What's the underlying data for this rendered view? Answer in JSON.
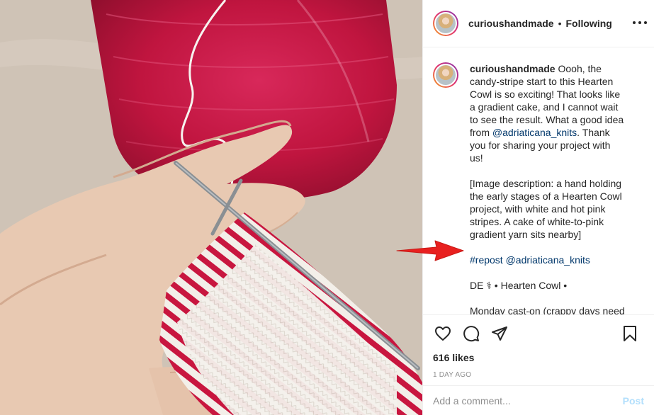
{
  "post": {
    "image_alt": "Hand holding a Hearten Cowl knitting project with white and hot pink stripes, with a cake of white-to-pink gradient yarn nearby",
    "header": {
      "username": "curioushandmade",
      "separator": "•",
      "follow_status": "Following"
    },
    "caption": {
      "username": "curioushandmade",
      "text1": " Oooh, the candy-stripe start to this Hearten Cowl is so exciting! That looks like a gradient cake, and I cannot wait to see the result. What a good idea from ",
      "mention1": "@adriaticana_knits",
      "text2": ". Thank you for sharing your project with us!",
      "para2": "[Image description: a hand holding the early stages of a Hearten Cowl project, with white and hot pink stripes. A cake of white-to-pink gradient yarn sits nearby]",
      "hashtag": "#repost",
      "mention2": "@adriaticana_knits",
      "para4": "DE ⚕ • Hearten Cowl •",
      "para5": "Monday cast-on (crappy days need some projects) #heartencowl"
    },
    "likes": "616 likes",
    "date": "1 DAY AGO",
    "comment_placeholder": "Add a comment...",
    "post_label": "Post"
  },
  "icons": [
    "more-options-icon",
    "heart-icon",
    "comment-icon",
    "share-icon",
    "bookmark-icon",
    "red-arrow-annotation-icon"
  ],
  "colors": {
    "link": "#00376b",
    "post_disabled": "#b2dffc",
    "muted": "#8e8e8e",
    "arrow": "#e8201f",
    "yarn": "#c5143f"
  }
}
